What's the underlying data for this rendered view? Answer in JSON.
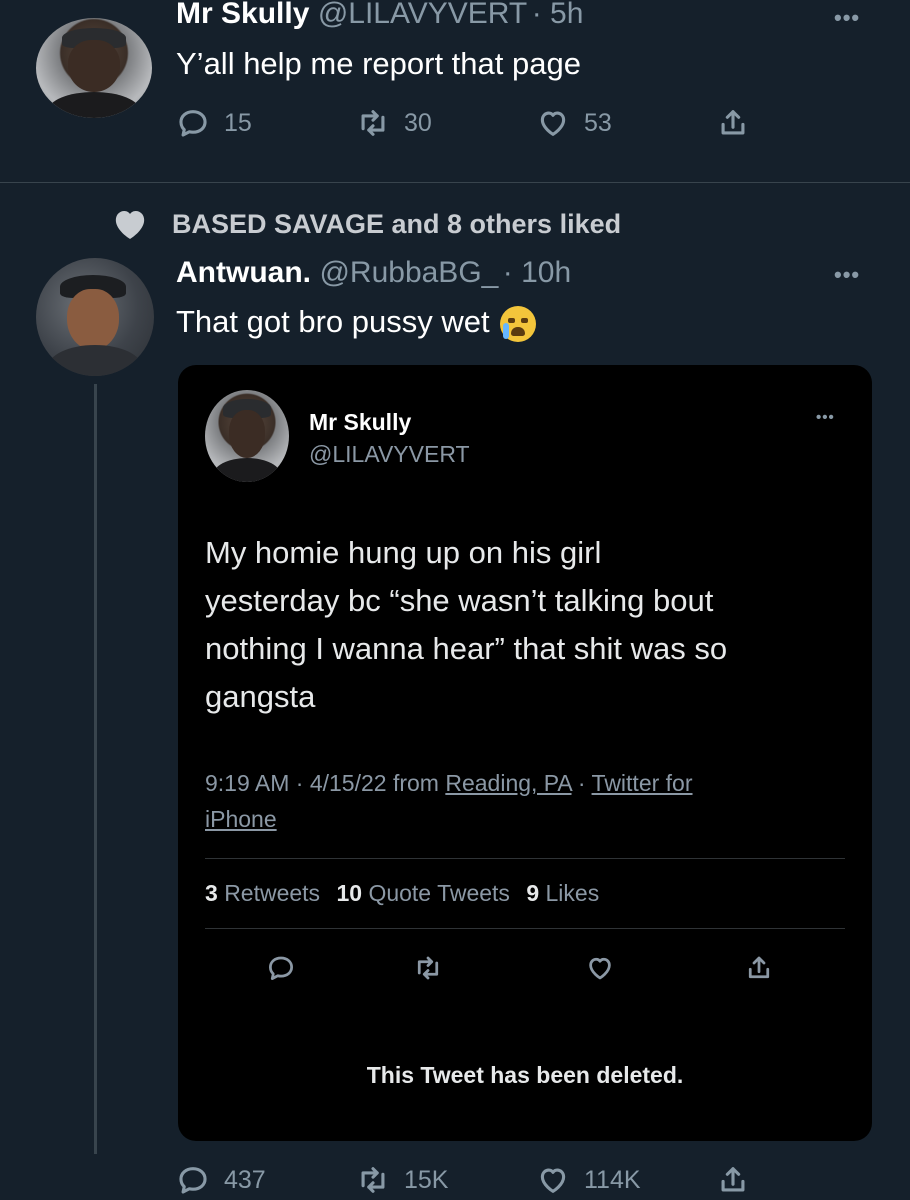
{
  "tweet1": {
    "name": "Mr Skully",
    "handle": "@LILAVYVERT",
    "time": "· 5h",
    "text": "Y’all help me report that page",
    "replies": "15",
    "retweets": "30",
    "likes": "53",
    "icons": [
      "reply-icon",
      "retweet-icon",
      "heart-icon",
      "share-icon"
    ]
  },
  "liked_banner": {
    "text": "BASED SAVAGE and 8 others liked",
    "icon": "heart-icon"
  },
  "tweet2": {
    "name": "Antwuan.",
    "handle": "@RubbaBG_",
    "time": "· 10h",
    "text": "That got bro pussy wet",
    "emoji": "crying-face-emoji",
    "replies": "437",
    "retweets": "15K",
    "likes": "114K"
  },
  "quoted": {
    "name": "Mr Skully",
    "handle": "@LILAVYVERT",
    "text_lines": [
      "My homie hung up on his girl",
      "yesterday bc “she wasn’t talking bout",
      "nothing I wanna hear” that shit was so",
      "gangsta"
    ],
    "meta_time": "9:19 AM · 4/15/22 from ",
    "meta_location": "Reading, PA",
    "meta_sep": " · ",
    "meta_client_1": "Twitter for",
    "meta_client_2": "iPhone",
    "stats": {
      "retweets_count": "3",
      "retweets_label": "Retweets",
      "quotes_count": "10",
      "quotes_label": "Quote Tweets",
      "likes_count": "9",
      "likes_label": "Likes"
    },
    "deleted_notice": "This Tweet has been deleted."
  },
  "colors": {
    "background": "#15202b",
    "card_background": "#000000",
    "secondary_text": "#8899a6",
    "divider": "#38444d"
  }
}
